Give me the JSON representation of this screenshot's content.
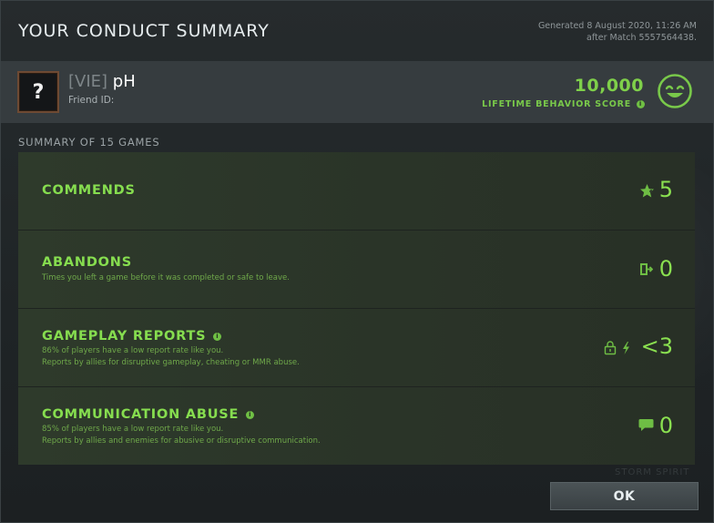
{
  "dialog": {
    "title": "YOUR CONDUCT SUMMARY",
    "generated_line1": "Generated 8 August 2020, 11:26 AM",
    "generated_line2": "after Match 5557564438."
  },
  "profile": {
    "avatar_glyph": "?",
    "tag": "[VIE]",
    "name": "pH",
    "friend_id_label": "Friend ID:",
    "score": "10,000",
    "score_label": "LIFETIME BEHAVIOR SCORE",
    "score_color": "#7fd04a"
  },
  "summary": {
    "heading": "SUMMARY OF 15 GAMES",
    "rows": [
      {
        "title": "COMMENDS",
        "desc1": "",
        "desc2": "",
        "icon": "star-icon",
        "value": "5"
      },
      {
        "title": "ABANDONS",
        "desc1": "Times you left a game before it was completed or safe to leave.",
        "desc2": "",
        "icon": "exit-door-icon",
        "value": "0"
      },
      {
        "title": "GAMEPLAY REPORTS",
        "desc1": "86% of players have a low report rate like you.",
        "desc2": "Reports by allies for disruptive gameplay, cheating or MMR abuse.",
        "icon": "lock-lightning-icon",
        "value": "<3"
      },
      {
        "title": "COMMUNICATION ABUSE",
        "desc1": "85% of players have a low report rate like you.",
        "desc2": "Reports by allies and enemies for abusive or disruptive communication.",
        "icon": "speech-bubble-icon",
        "value": "0"
      }
    ]
  },
  "footer": {
    "ok_label": "OK",
    "watermark": "STORM SPIRIT"
  }
}
